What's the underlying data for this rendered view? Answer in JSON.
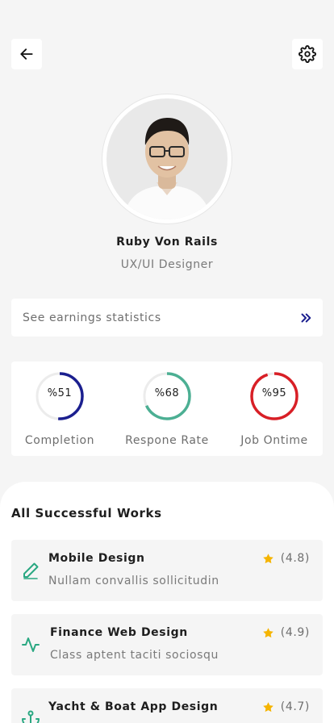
{
  "header": {
    "back_icon": "arrow-left-icon",
    "settings_icon": "gear-icon"
  },
  "profile": {
    "name": "Ruby Von Rails",
    "role": "UX/UI Designer",
    "avatar_icon": "user-photo"
  },
  "earnings": {
    "label": "See earnings statistics",
    "icon": "double-chevron-right-icon",
    "accent": "#1b1f8f"
  },
  "stats": [
    {
      "label": "Completion",
      "percent_text": "%51",
      "value": 51,
      "color": "#1b1f8f"
    },
    {
      "label": "Respone Rate",
      "percent_text": "%68",
      "value": 68,
      "color": "#4caf93"
    },
    {
      "label": "Job Ontime",
      "percent_text": "%95",
      "value": 95,
      "color": "#d81f26"
    }
  ],
  "works": {
    "title": "All Successful Works",
    "star_color": "#f5b400",
    "accent": "#2aa882",
    "items": [
      {
        "title": "Mobile Design",
        "subtitle": "Nullam convallis sollicitudin",
        "rating": "(4.8)",
        "icon": "pencil-icon"
      },
      {
        "title": "Finance Web Design",
        "subtitle": "Class aptent taciti sociosqu",
        "rating": "(4.9)",
        "icon": "activity-icon"
      },
      {
        "title": "Yacht & Boat App Design",
        "subtitle": "",
        "rating": "(4.7)",
        "icon": "anchor-icon"
      }
    ]
  }
}
